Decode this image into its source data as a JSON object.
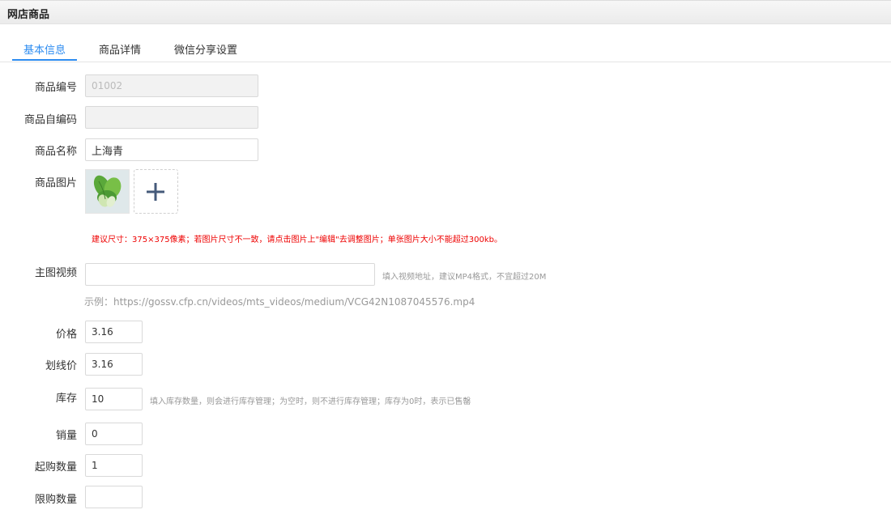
{
  "page_title": "网店商品",
  "tabs": [
    {
      "label": "基本信息",
      "active": true
    },
    {
      "label": "商品详情",
      "active": false
    },
    {
      "label": "微信分享设置",
      "active": false
    }
  ],
  "fields": {
    "code": {
      "label": "商品编号",
      "value": "01002"
    },
    "self_code": {
      "label": "商品自编码",
      "value": ""
    },
    "name": {
      "label": "商品名称",
      "value": "上海青"
    },
    "image": {
      "label": "商品图片",
      "hint": "建议尺寸：375×375像素；若图片尺寸不一致，请点击图片上\"编辑\"去调整图片；单张图片大小不能超过300kb。"
    },
    "video": {
      "label": "主图视频",
      "value": "",
      "hint": "填入视频地址，建议MP4格式，不宜超过20M",
      "example": "示例：https://gossv.cfp.cn/videos/mts_videos/medium/VCG42N1087045576.mp4"
    },
    "price": {
      "label": "价格",
      "value": "3.16"
    },
    "original_price": {
      "label": "划线价",
      "value": "3.16"
    },
    "stock": {
      "label": "库存",
      "value": "10",
      "hint": "填入库存数量，则会进行库存管理；为空时，则不进行库存管理；库存为0时，表示已售罄"
    },
    "sales": {
      "label": "销量",
      "value": "0"
    },
    "min_purchase": {
      "label": "起购数量",
      "value": "1"
    },
    "max_purchase": {
      "label": "限购数量",
      "value": ""
    }
  },
  "colors": {
    "accent": "#2d8cf0",
    "warning": "#e00000"
  },
  "icons": {
    "add_image": "plus-icon",
    "product_thumbnail": "bok-choy-image"
  }
}
